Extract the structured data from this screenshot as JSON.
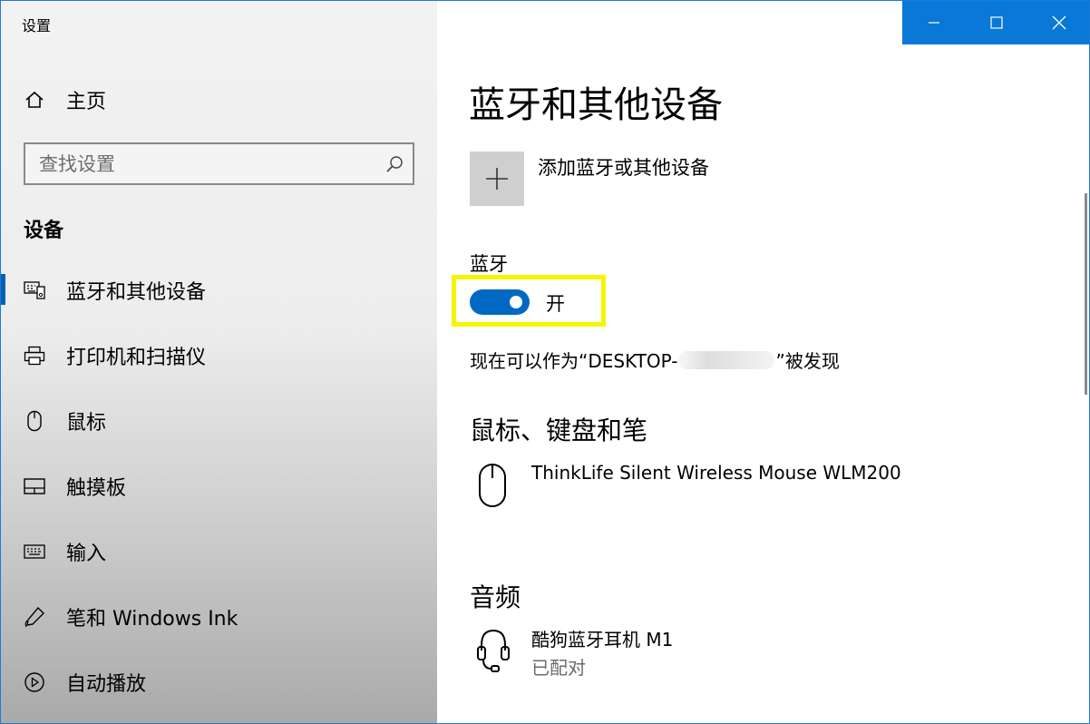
{
  "app": {
    "title": "设置"
  },
  "window_controls": {
    "minimize": "—",
    "maximize": "☐",
    "close": "✕"
  },
  "sidebar": {
    "home_label": "主页",
    "search_placeholder": "查找设置",
    "section": "设备",
    "items": [
      {
        "label": "蓝牙和其他设备",
        "icon": "bluetooth-devices-icon",
        "active": true
      },
      {
        "label": "打印机和扫描仪",
        "icon": "printer-icon",
        "active": false
      },
      {
        "label": "鼠标",
        "icon": "mouse-icon",
        "active": false
      },
      {
        "label": "触摸板",
        "icon": "touchpad-icon",
        "active": false
      },
      {
        "label": "输入",
        "icon": "keyboard-icon",
        "active": false
      },
      {
        "label": "笔和 Windows Ink",
        "icon": "pen-icon",
        "active": false
      },
      {
        "label": "自动播放",
        "icon": "autoplay-icon",
        "active": false
      }
    ]
  },
  "main": {
    "title": "蓝牙和其他设备",
    "add_device_label": "添加蓝牙或其他设备",
    "bluetooth": {
      "label": "蓝牙",
      "toggle_state": "开",
      "toggle_on": true,
      "discoverable_prefix": "现在可以作为“DESKTOP-",
      "discoverable_suffix": "”被发现"
    },
    "groups": [
      {
        "heading": "鼠标、键盘和笔",
        "devices": [
          {
            "name": "ThinkLife Silent Wireless Mouse WLM200",
            "status": "",
            "icon": "mouse-icon"
          }
        ]
      },
      {
        "heading": "音频",
        "devices": [
          {
            "name": "酷狗蓝牙耳机 M1",
            "status": "已配对",
            "icon": "headset-icon"
          }
        ]
      }
    ]
  },
  "colors": {
    "accent": "#0069c4",
    "titlebar_blue": "#0a78d7",
    "highlight": "#f5f500"
  }
}
